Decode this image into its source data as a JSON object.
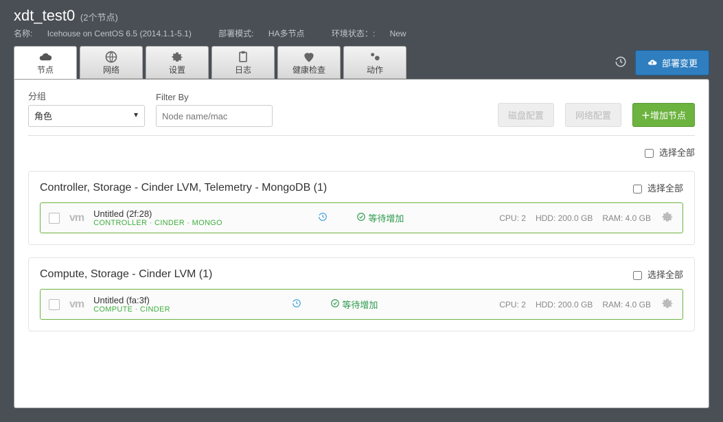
{
  "header": {
    "title": "xdt_test0",
    "count_label": "(2个节点)",
    "name_label": "名称:",
    "name_value": "Icehouse on CentOS 6.5 (2014.1.1-5.1)",
    "deploy_mode_label": "部署模式:",
    "deploy_mode_value": "HA多节点",
    "env_status_label": "环境状态：:",
    "env_status_value": "New"
  },
  "tabs": {
    "nodes": "节点",
    "network": "网络",
    "settings": "设置",
    "logs": "日志",
    "health": "健康检查",
    "actions": "动作"
  },
  "actions": {
    "deploy": "部署变更"
  },
  "controls": {
    "group_label": "分组",
    "group_selected": "角色",
    "filter_label": "Filter By",
    "filter_placeholder": "Node name/mac",
    "disk_btn": "磁盘配置",
    "net_btn": "网络配置",
    "add_btn_prefix": "＋",
    "add_btn": "增加节点"
  },
  "select_all": "选择全部",
  "groups": [
    {
      "title": "Controller, Storage - Cinder LVM, Telemetry - MongoDB (1)",
      "node": {
        "name": "Untitled (2f:28)",
        "roles": "CONTROLLER · CINDER · MONGO",
        "status": "等待增加",
        "cpu": "CPU: 2",
        "hdd": "HDD: 200.0 GB",
        "ram": "RAM: 4.0 GB"
      }
    },
    {
      "title": "Compute, Storage - Cinder LVM (1)",
      "node": {
        "name": "Untitled (fa:3f)",
        "roles": "COMPUTE · CINDER",
        "status": "等待增加",
        "cpu": "CPU: 2",
        "hdd": "HDD: 200.0 GB",
        "ram": "RAM: 4.0 GB"
      }
    }
  ]
}
